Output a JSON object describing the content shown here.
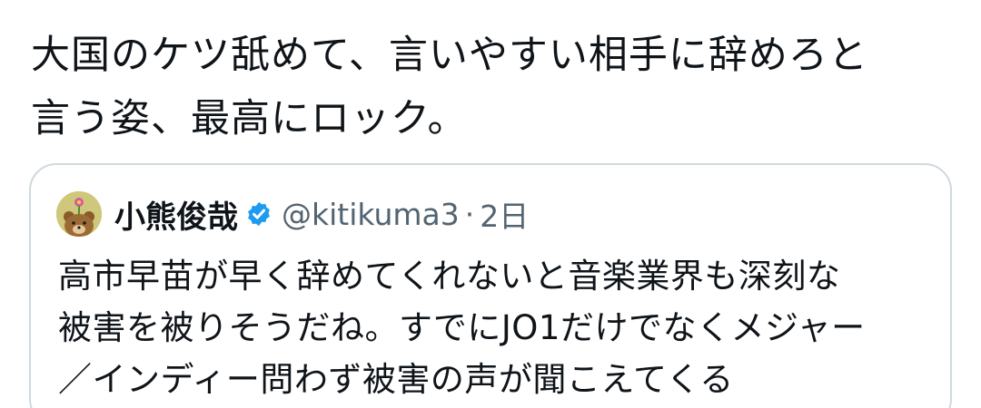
{
  "tweet": {
    "text": "大国のケツ舐めて、言いやすい相手に辞めろと\n言う姿、最高にロック。"
  },
  "quote": {
    "display_name": "小熊俊哉",
    "handle": "@kitikuma3",
    "separator": "·",
    "timestamp": "2日",
    "text": "高市早苗が早く辞めてくれないと音楽業界も深刻な\n被害を被りそうだね。すでにJO1だけでなくメジャー\n／インディー問わず被害の声が聞こえてくる",
    "avatar_icon": "bear-with-flower-avatar",
    "verified_icon": "verified-badge-icon"
  },
  "colors": {
    "text_primary": "#0f1419",
    "text_secondary": "#536471",
    "border": "#cfd9de",
    "verified": "#1d9bf0"
  }
}
